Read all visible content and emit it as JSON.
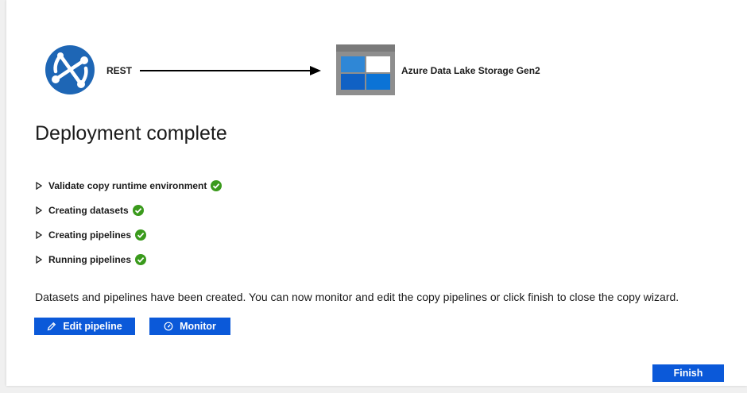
{
  "flow": {
    "source_label": "REST",
    "destination_label": "Azure Data Lake Storage Gen2",
    "source_icon": "rest-api-icon",
    "destination_icon": "data-lake-storage-icon"
  },
  "title": "Deployment complete",
  "steps": [
    {
      "label": "Validate copy runtime environment",
      "status": "success"
    },
    {
      "label": "Creating datasets",
      "status": "success"
    },
    {
      "label": "Creating pipelines",
      "status": "success"
    },
    {
      "label": "Running pipelines",
      "status": "success"
    }
  ],
  "message": "Datasets and pipelines have been created. You can now monitor and edit the copy pipelines or click finish to close the copy wizard.",
  "buttons": {
    "edit_pipeline": "Edit pipeline",
    "monitor": "Monitor",
    "finish": "Finish"
  },
  "colors": {
    "accent": "#0b59d9",
    "success": "#3a9a1c",
    "rest_icon": "#1e66b5"
  }
}
